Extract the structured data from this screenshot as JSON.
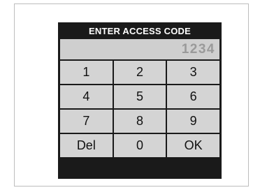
{
  "keypad": {
    "title": "ENTER ACCESS CODE",
    "display_value": "1234",
    "keys": [
      "1",
      "2",
      "3",
      "4",
      "5",
      "6",
      "7",
      "8",
      "9",
      "Del",
      "0",
      "OK"
    ]
  }
}
